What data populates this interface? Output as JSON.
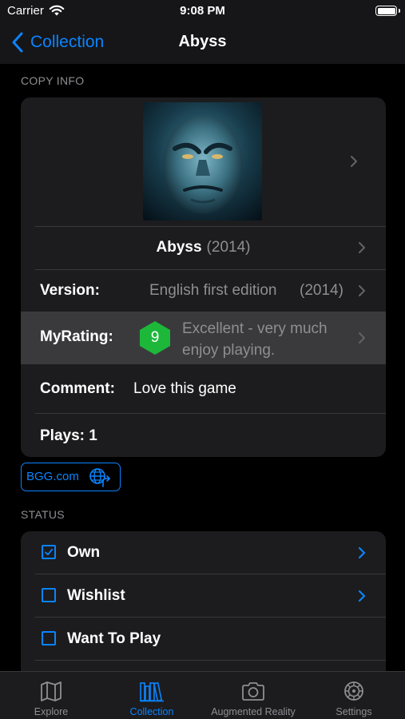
{
  "status_bar": {
    "carrier": "Carrier",
    "time": "9:08 PM"
  },
  "nav": {
    "back_label": "Collection",
    "title": "Abyss"
  },
  "copy_info": {
    "header": "COPY INFO",
    "game_name": "Abyss",
    "game_year": "(2014)",
    "version_label": "Version:",
    "version_value": "English first edition",
    "version_year": "(2014)",
    "rating_label": "MyRating:",
    "rating_value": "9",
    "rating_color": "#1db83a",
    "rating_text": "Excellent - very much enjoy playing.",
    "comment_label": "Comment:",
    "comment_value": "Love this game",
    "plays_label": "Plays: 1"
  },
  "bgg_button": {
    "label": "BGG.com",
    "icon": "globe-icon"
  },
  "status": {
    "header": "STATUS",
    "items": [
      {
        "label": "Own",
        "checked": true,
        "has_chevron": true
      },
      {
        "label": "Wishlist",
        "checked": false,
        "has_chevron": true
      },
      {
        "label": "Want To Play",
        "checked": false,
        "has_chevron": false
      }
    ]
  },
  "tabs": [
    {
      "label": "Explore",
      "icon": "map-icon",
      "active": false
    },
    {
      "label": "Collection",
      "icon": "books-icon",
      "active": true
    },
    {
      "label": "Augmented Reality",
      "icon": "camera-icon",
      "active": false
    },
    {
      "label": "Settings",
      "icon": "gear-icon",
      "active": false
    }
  ],
  "colors": {
    "accent": "#0a84ff",
    "card_bg": "#1c1c1e",
    "highlight_row": "#3a3a3c"
  }
}
